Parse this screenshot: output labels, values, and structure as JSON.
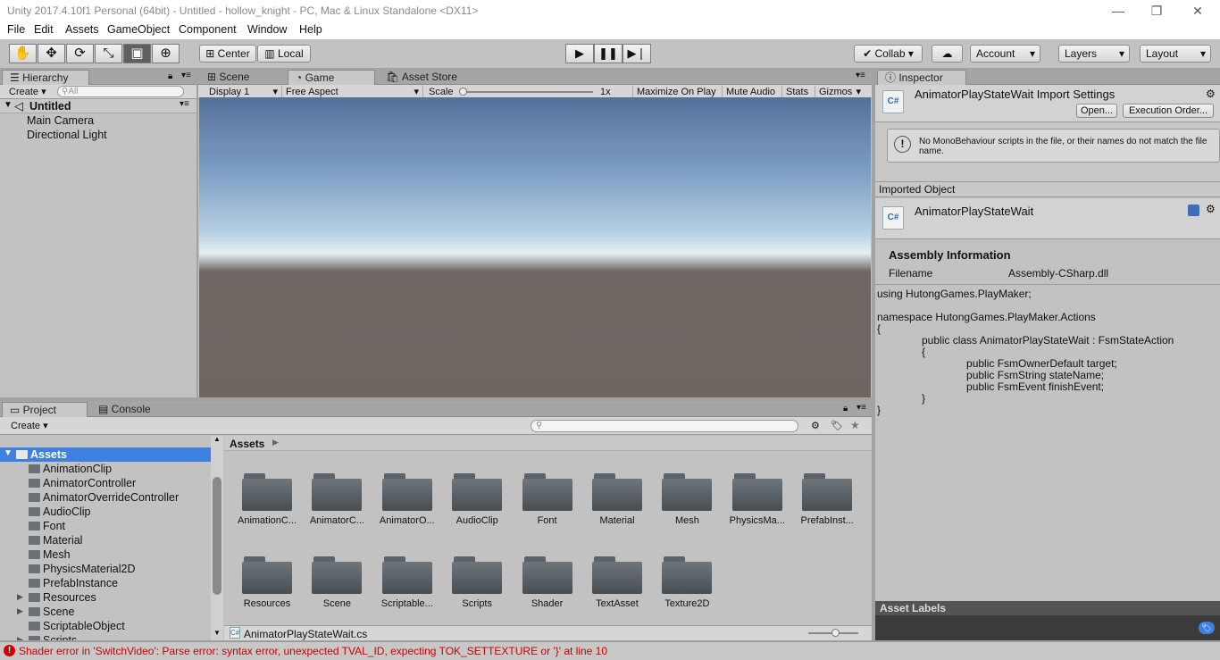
{
  "window": {
    "title": "Unity 2017.4.10f1 Personal (64bit) - Untitled - hollow_knight - PC, Mac & Linux Standalone <DX11>",
    "minimize": "—",
    "maximize": "❐",
    "close": "✕"
  },
  "menu": [
    "File",
    "Edit",
    "Assets",
    "GameObject",
    "Component",
    "Window",
    "Help"
  ],
  "toolbar": {
    "tools": [
      "hand-tool",
      "move-tool",
      "rotate-tool",
      "scale-tool",
      "rect-tool",
      "transform-tool"
    ],
    "pivot": "Center",
    "space": "Local",
    "collab": "Collab ▾",
    "account": "Account",
    "layers": "Layers",
    "layout": "Layout"
  },
  "hierarchy": {
    "tab": "Hierarchy",
    "create": "Create",
    "search_placeholder": "All",
    "scene": "Untitled",
    "items": [
      "Main Camera",
      "Directional Light"
    ]
  },
  "views": {
    "tabs": [
      "Scene",
      "Game",
      "Asset Store"
    ],
    "display": "Display 1",
    "aspect": "Free Aspect",
    "scale_label": "Scale",
    "scale_value": "1x",
    "maximize": "Maximize On Play",
    "mute": "Mute Audio",
    "stats": "Stats",
    "gizmos": "Gizmos"
  },
  "project": {
    "tabs": [
      "Project",
      "Console"
    ],
    "create": "Create",
    "root": "Assets",
    "breadcrumb": "Assets",
    "tree": [
      {
        "label": "AnimationClip",
        "expandable": false
      },
      {
        "label": "AnimatorController",
        "expandable": false
      },
      {
        "label": "AnimatorOverrideController",
        "expandable": false
      },
      {
        "label": "AudioClip",
        "expandable": false
      },
      {
        "label": "Font",
        "expandable": false
      },
      {
        "label": "Material",
        "expandable": false
      },
      {
        "label": "Mesh",
        "expandable": false
      },
      {
        "label": "PhysicsMaterial2D",
        "expandable": false
      },
      {
        "label": "PrefabInstance",
        "expandable": false
      },
      {
        "label": "Resources",
        "expandable": true
      },
      {
        "label": "Scene",
        "expandable": true
      },
      {
        "label": "ScriptableObject",
        "expandable": false
      },
      {
        "label": "Scripts",
        "expandable": true
      }
    ],
    "grid_row1": [
      "AnimationC...",
      "AnimatorC...",
      "AnimatorO...",
      "AudioClip",
      "Font",
      "Material",
      "Mesh",
      "PhysicsMa...",
      "PrefabInst..."
    ],
    "grid_row2": [
      "Resources",
      "Scene",
      "Scriptable...",
      "Scripts",
      "Shader",
      "TextAsset",
      "Texture2D"
    ],
    "selected_file": "AnimatorPlayStateWait.cs"
  },
  "inspector": {
    "tab": "Inspector",
    "title": "AnimatorPlayStateWait Import Settings",
    "open_button": "Open...",
    "exec_order_button": "Execution Order...",
    "warning": "No MonoBehaviour scripts in the file, or their names do not match the file name.",
    "imported_object_label": "Imported Object",
    "object_name": "AnimatorPlayStateWait",
    "assembly_header": "Assembly Information",
    "filename_label": "Filename",
    "filename_value": "Assembly-CSharp.dll",
    "code_lines": [
      "using HutongGames.PlayMaker;",
      "",
      "namespace HutongGames.PlayMaker.Actions",
      "{",
      "               public class AnimatorPlayStateWait : FsmStateAction",
      "               {",
      "                              public FsmOwnerDefault target;",
      "                              public FsmString stateName;",
      "                              public FsmEvent finishEvent;",
      "               }",
      "}"
    ],
    "asset_labels": "Asset Labels"
  },
  "status": {
    "error": "Shader error in 'SwitchVideo': Parse error: syntax error, unexpected TVAL_ID, expecting TOK_SETTEXTURE or '}' at line 10"
  },
  "colors": {
    "accent_selection": "#3d80df",
    "panel_bg": "#c2c2c2",
    "error_red": "#cc0000"
  }
}
